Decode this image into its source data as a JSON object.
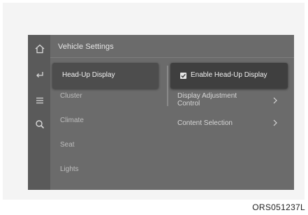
{
  "screen": {
    "title": "Vehicle Settings",
    "sidebar_icons": [
      "home-icon",
      "back-icon",
      "menu-icon",
      "search-icon"
    ],
    "menu_items": [
      "Head-Up Display",
      "Cluster",
      "Climate",
      "Seat",
      "Lights"
    ],
    "selected_menu": "Head-Up Display",
    "options": [
      {
        "label": "Enable Head-Up Display",
        "checked": true
      },
      {
        "label": "Display Adjustment Control",
        "label_lines": [
          "Display Adjustment",
          "Control"
        ]
      },
      {
        "label": "Content Selection"
      }
    ]
  },
  "reference_code": "ORS051237L"
}
